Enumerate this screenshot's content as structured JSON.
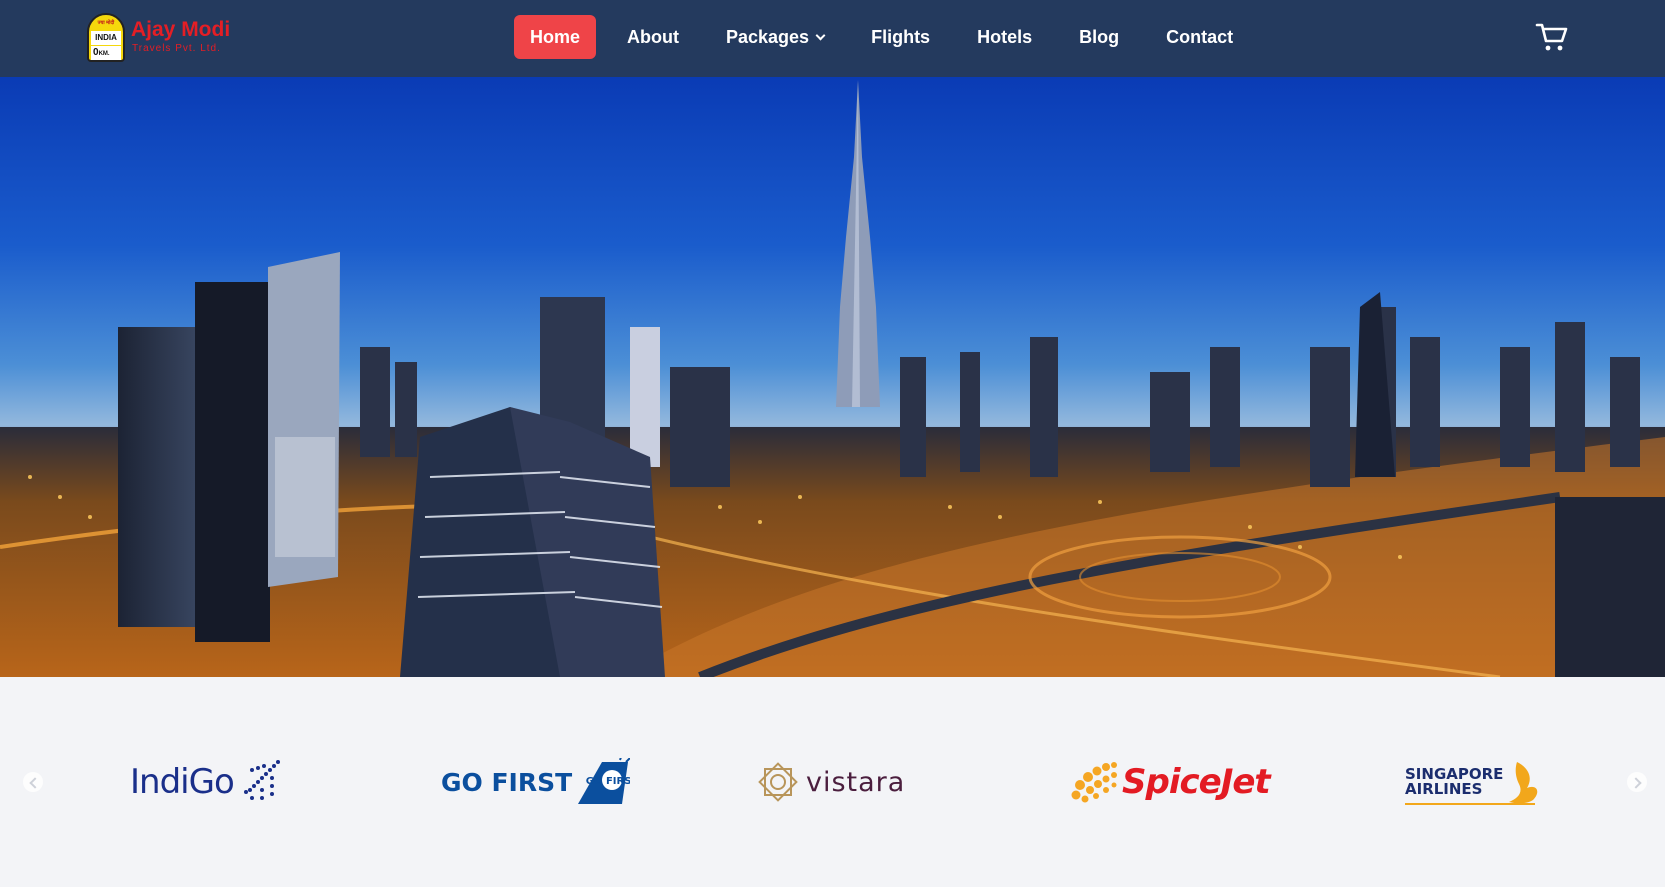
{
  "brand": {
    "name": "Ajay Modi",
    "subtitle": "Travels Pvt. Ltd.",
    "badge_top": "ज्या मोदी",
    "badge_mid": "INDIA",
    "badge_bottom": "0",
    "badge_unit": "KM.",
    "color": "#e41e25"
  },
  "nav": {
    "items": [
      {
        "label": "Home",
        "active": true
      },
      {
        "label": "About"
      },
      {
        "label": "Packages",
        "has_dropdown": true
      },
      {
        "label": "Flights"
      },
      {
        "label": "Hotels"
      },
      {
        "label": "Blog"
      },
      {
        "label": "Contact"
      }
    ],
    "cart_icon": "cart-icon",
    "active_color": "#ef4448",
    "background": "#243a5e"
  },
  "hero": {
    "image": "city-skyline-night-photo"
  },
  "airlines": {
    "prev_icon": "chevron-left-icon",
    "next_icon": "chevron-right-icon",
    "logos": [
      {
        "name": "IndiGo",
        "color": "#1a2f8a"
      },
      {
        "name": "GO FIRST",
        "mark": "GO FIRST",
        "color": "#0b4f9e"
      },
      {
        "name": "vistara",
        "color": "#4b1e3e"
      },
      {
        "name": "SpiceJet",
        "color": "#e31b23"
      },
      {
        "line1": "SINGAPORE",
        "line2": "AIRLINES",
        "color": "#1b2d6e"
      }
    ]
  }
}
